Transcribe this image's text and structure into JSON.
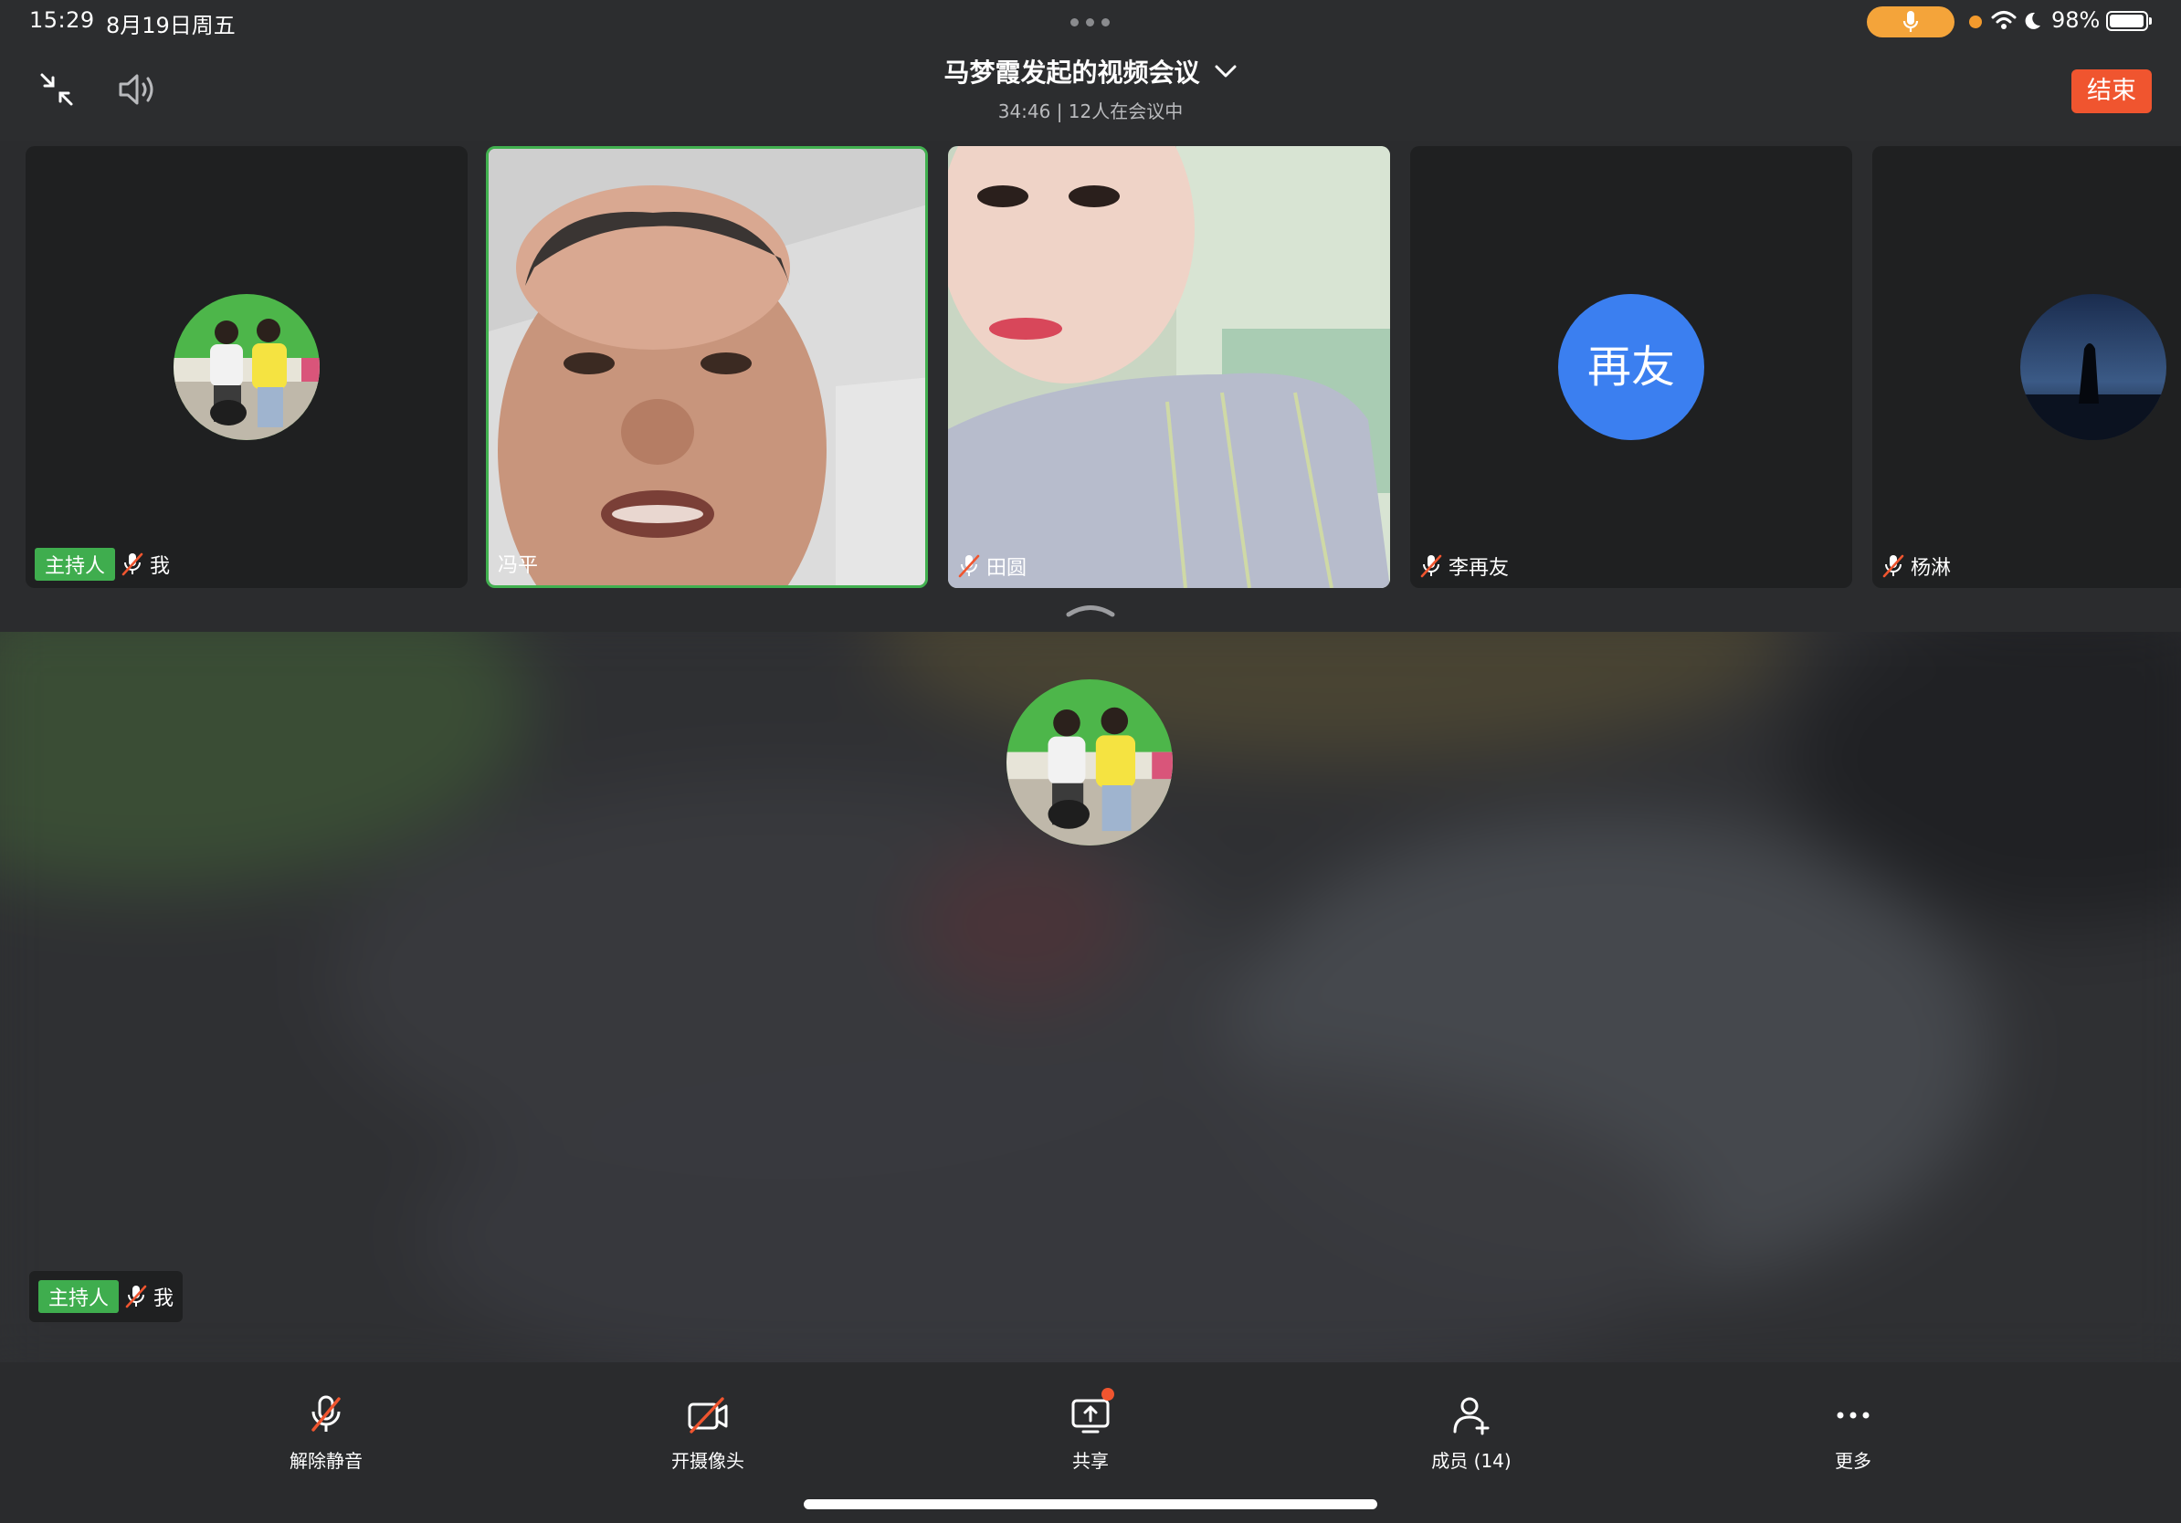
{
  "status_bar": {
    "time": "15:29",
    "date": "8月19日周五",
    "battery": "98%",
    "battery_level": 0.98
  },
  "header": {
    "title": "马梦霞发起的视频会议",
    "subtitle": "34:46 | 12人在会议中",
    "end_label": "结束"
  },
  "tiles": [
    {
      "name": "我",
      "host_badge": "主持人",
      "muted": true,
      "kind": "avatar-photo"
    },
    {
      "name": "冯平",
      "muted": false,
      "active": true,
      "kind": "video"
    },
    {
      "name": "田圆",
      "muted": true,
      "kind": "video"
    },
    {
      "name": "李再友",
      "muted": true,
      "kind": "avatar-text",
      "avatar_text": "再友"
    },
    {
      "name": "杨淋",
      "muted": true,
      "kind": "avatar-photo"
    }
  ],
  "stage": {
    "host_badge": "主持人",
    "name": "我"
  },
  "toolbar": {
    "unmute": "解除静音",
    "camera": "开摄像头",
    "share": "共享",
    "members": "成员 (14)",
    "more": "更多"
  },
  "colors": {
    "host_green": "#3fad4e",
    "end_red": "#f0552f",
    "avatar_blue": "#3b7ff0",
    "active_border": "#41b04f",
    "mic_pill": "#f4a43a"
  }
}
